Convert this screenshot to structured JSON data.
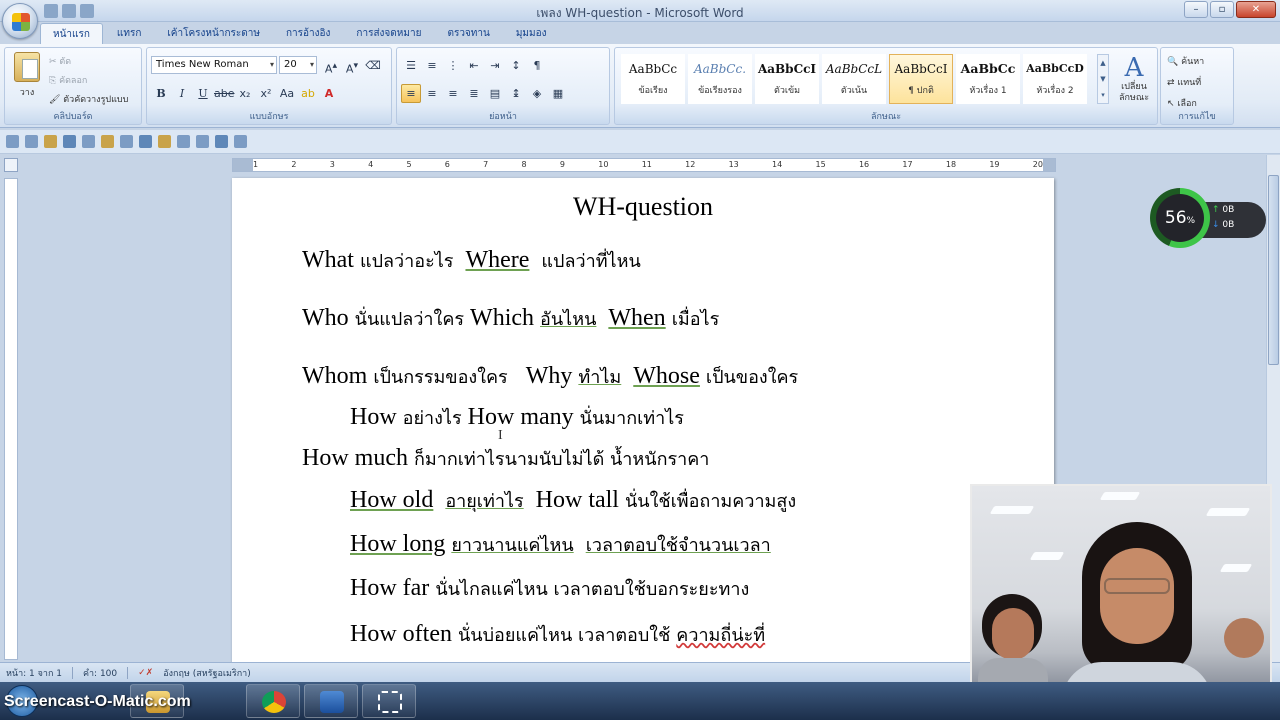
{
  "window": {
    "title": "เพลง WH-question - Microsoft Word"
  },
  "tabs": [
    "หน้าแรก",
    "แทรก",
    "เค้าโครงหน้ากระดาษ",
    "การอ้างอิง",
    "การส่งจดหมาย",
    "ตรวจทาน",
    "มุมมอง"
  ],
  "clipboard": {
    "paste_label": "วาง",
    "cut": "ตัด",
    "copy": "คัดลอก",
    "format_painter": "ตัวคัดวางรูปแบบ",
    "group_label": "คลิปบอร์ด"
  },
  "font": {
    "name": "Times New Roman",
    "size": "20",
    "group_label": "แบบอักษร"
  },
  "paragraph": {
    "group_label": "ย่อหน้า"
  },
  "styles": {
    "items": [
      {
        "sample": "AaBbCc",
        "name": "ข้อเรียง"
      },
      {
        "sample": "AaBbCc.",
        "name": "ข้อเรียงรอง"
      },
      {
        "sample": "AaBbCcI",
        "name": "ตัวเข้ม"
      },
      {
        "sample": "AaBbCcL",
        "name": "ตัวเน้น"
      },
      {
        "sample": "AaBbCcI",
        "name": "¶ ปกติ"
      },
      {
        "sample": "AaBbCc",
        "name": "หัวเรื่อง 1"
      },
      {
        "sample": "AaBbCcD",
        "name": "หัวเรื่อง 2"
      }
    ],
    "change_label": "เปลี่ยน ลักษณะ",
    "group_label": "ลักษณะ"
  },
  "editing": {
    "find": "ค้นหา",
    "replace": "แทนที่",
    "select": "เลือก",
    "group_label": "การแก้ไข"
  },
  "ruler_ticks": [
    "1",
    "2",
    "3",
    "4",
    "5",
    "6",
    "7",
    "8",
    "9",
    "10",
    "11",
    "12",
    "13",
    "14",
    "15",
    "16",
    "17",
    "18",
    "19",
    "20"
  ],
  "document": {
    "title": "WH-question",
    "l1": {
      "w1": "What",
      "t1": "แปลว่าอะไร",
      "w2": "Where",
      "t2": "แปลว่าที่ไหน"
    },
    "l2": {
      "w1": "Who",
      "t1": "นั่นแปลว่าใคร",
      "w2": "Which",
      "t2": "อันไหน",
      "w3": "When",
      "t3": "เมื่อไร"
    },
    "l3": {
      "w1": "Whom",
      "t1": "เป็นกรรมของใคร",
      "w2": "Why",
      "t2": "ทำไม",
      "w3": "Whose",
      "t3": "เป็นของใคร"
    },
    "l4": {
      "w1": "How",
      "t1": "อย่างไร",
      "w2": "How many",
      "t2": "นั่นมากเท่าไร"
    },
    "l5": {
      "w1": "How much",
      "t1": "ก็มากเท่าไรนามนับไม่ได้ น้ำหนักราคา"
    },
    "l6": {
      "w1": "How old",
      "t1": "อายุเท่าไร",
      "w2": "How tall",
      "t2": "นั่นใช้เพื่อถามความสูง"
    },
    "l7": {
      "w1": "How long",
      "t1": "ยาวนานแค่ไหน",
      "t2": "เวลาตอบใช้จำนวนเวลา"
    },
    "l8": {
      "w1": "How far",
      "t1": "นั่นไกลแค่ไหน เวลาตอบใช้บอกระยะทาง"
    },
    "l9": {
      "w1": "How often",
      "t1": "นั่นบ่อยแค่ไหน เวลาตอบใช้",
      "t2": "ความถี่น่ะที่"
    }
  },
  "status": {
    "page": "หน้า: 1 จาก 1",
    "words": "คำ: 100",
    "language": "อังกฤษ (สหรัฐอเมริกา)"
  },
  "net_meter": {
    "percent": 56,
    "percent_text": "56",
    "unit": "%",
    "up": "0B",
    "down": "0B"
  },
  "watermark": "Screencast-O-Matic.com",
  "colors": {
    "ribbon": "#e2ebf6",
    "accent": "#15428b",
    "net_green": "#3ec548"
  }
}
